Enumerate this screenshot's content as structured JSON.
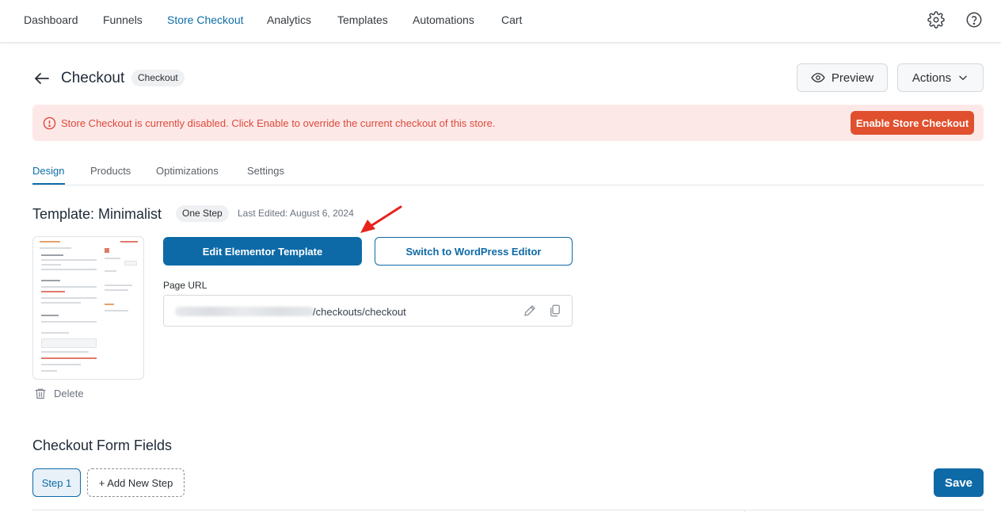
{
  "nav": {
    "items": [
      {
        "label": "Dashboard"
      },
      {
        "label": "Funnels"
      },
      {
        "label": "Store Checkout"
      },
      {
        "label": "Analytics"
      },
      {
        "label": "Templates"
      },
      {
        "label": "Automations"
      },
      {
        "label": "Cart"
      }
    ],
    "active": "Store Checkout",
    "icons": [
      "gear-icon",
      "help-icon"
    ]
  },
  "header": {
    "title": "Checkout",
    "badge": "Checkout",
    "preview_label": "Preview",
    "actions_label": "Actions"
  },
  "alert": {
    "text": "Store Checkout is currently disabled. Click Enable to override the current checkout of this store.",
    "button_label": "Enable Store Checkout"
  },
  "tabs": [
    {
      "label": "Design"
    },
    {
      "label": "Products"
    },
    {
      "label": "Optimizations"
    },
    {
      "label": "Settings"
    }
  ],
  "active_tab": "Design",
  "template": {
    "title": "Template: Minimalist",
    "badge": "One Step",
    "last_edited": "Last Edited: August 6, 2024",
    "delete_label": "Delete",
    "edit_button": "Edit Elementor Template",
    "switch_button": "Switch to WordPress Editor",
    "url_label": "Page URL",
    "url_path": "/checkouts/checkout"
  },
  "form_fields": {
    "title": "Checkout Form Fields",
    "step_label": "Step 1",
    "add_step_label": "+ Add New Step",
    "save_label": "Save"
  },
  "colors": {
    "primary": "#0e6aa7",
    "alert_bg": "#fde8e8",
    "alert_text": "#dc4a3a",
    "enable_button": "#e0502e",
    "annotation_arrow": "#e8231c"
  }
}
